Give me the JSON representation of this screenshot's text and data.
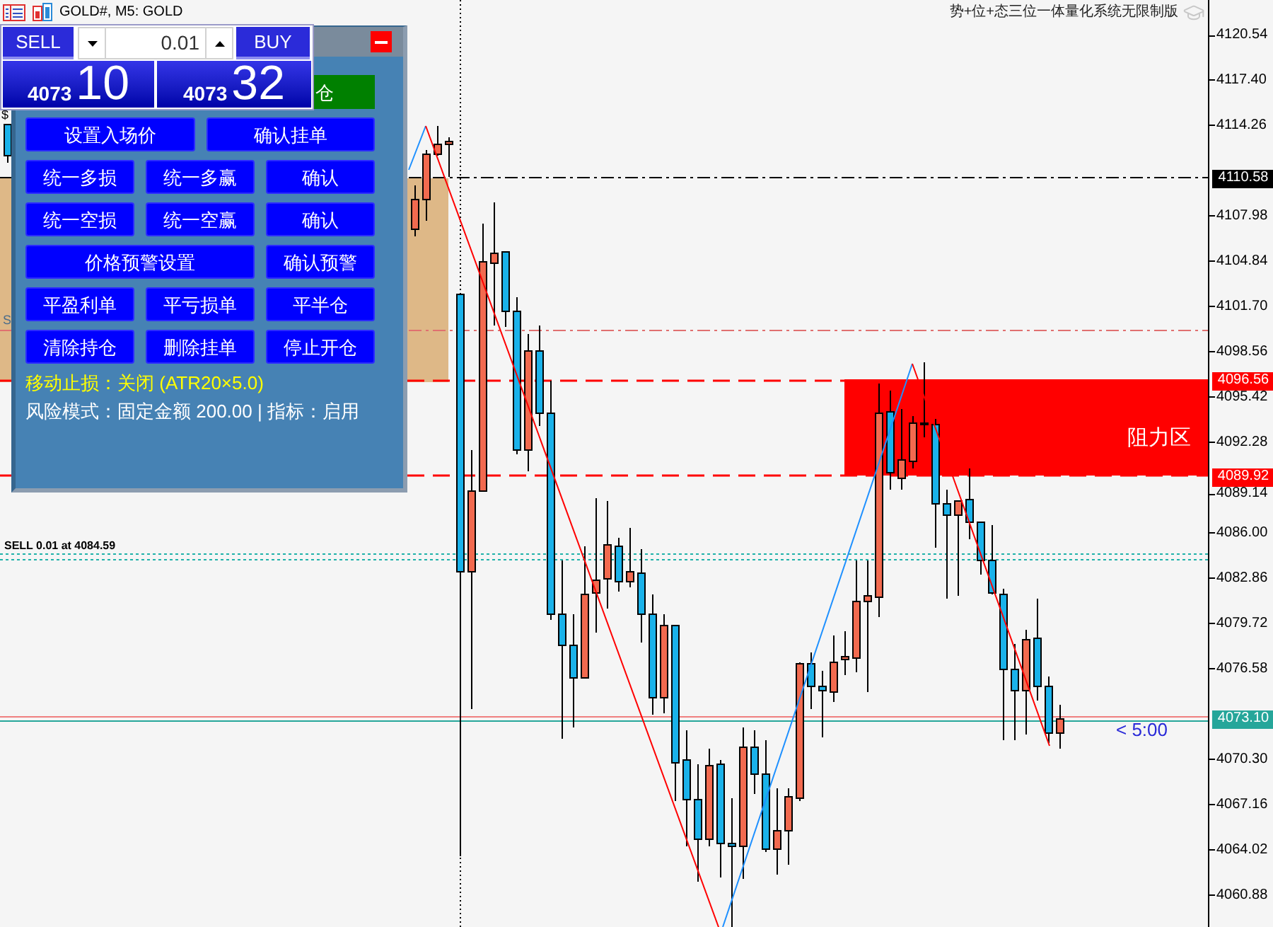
{
  "window": {
    "title": "GOLD#, M5: GOLD"
  },
  "caption": "势+位+态三位一体量化系统无限制版",
  "one_click": {
    "sell": "SELL",
    "buy": "BUY",
    "volume": "0.01",
    "sell_price": {
      "base": "4073",
      "pips": "10"
    },
    "buy_price": {
      "base": "4073",
      "pips": "32"
    }
  },
  "panel": {
    "top_button": "仓",
    "rows": [
      [
        "设置入场价",
        "确认挂单"
      ],
      [
        "统一多损",
        "统一多赢",
        "确认"
      ],
      [
        "统一空损",
        "统一空赢",
        "确认"
      ],
      [
        "价格预警设置",
        "确认预警"
      ],
      [
        "平盈利单",
        "平亏损单",
        "平半仓"
      ],
      [
        "清除持仓",
        "删除挂单",
        "停止开仓"
      ]
    ],
    "status_lines": [
      {
        "text": "移动止损：关闭 (ATR20×5.0)",
        "color": "#ffff00"
      },
      {
        "text": "风险模式：固定金额 200.00 | 指标：启用",
        "color": "#ffffff"
      }
    ]
  },
  "chart": {
    "edge_labels": [
      "$",
      "S"
    ],
    "order_label": "SELL 0.01 at 4084.59",
    "zone_label": "阻力区",
    "timer": "< 5:00"
  },
  "price_axis": {
    "ticks": [
      "4120.54",
      "4117.40",
      "4114.26",
      "4107.98",
      "4104.84",
      "4101.70",
      "4098.56",
      "4095.42",
      "4092.28",
      "4089.14",
      "4086.00",
      "4082.86",
      "4079.72",
      "4076.58",
      "4070.30",
      "4067.16",
      "4064.02",
      "4060.88"
    ],
    "markers": [
      {
        "label": "4110.58",
        "color": "#000000"
      },
      {
        "label": "4096.56",
        "color": "#ff0000"
      },
      {
        "label": "4089.92",
        "color": "#ff0000"
      },
      {
        "label": "4073.10",
        "color": "#26a69a"
      }
    ]
  }
}
